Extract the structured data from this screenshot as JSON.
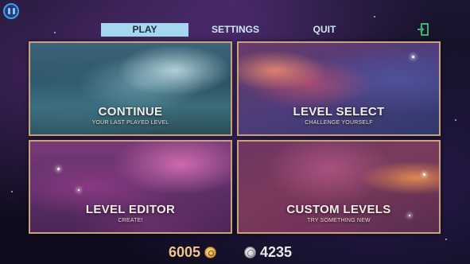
{
  "nav": {
    "tabs": [
      {
        "label": "PLAY",
        "active": true
      },
      {
        "label": "SETTINGS",
        "active": false
      },
      {
        "label": "QUIT",
        "active": false
      }
    ],
    "pause_icon": "pause-icon",
    "exit_icon": "exit-door-icon"
  },
  "cards": [
    {
      "title": "CONTINUE",
      "subtitle": "YOUR LAST PLAYED LEVEL"
    },
    {
      "title": "LEVEL SELECT",
      "subtitle": "CHALLENGE YOURSELF"
    },
    {
      "title": "LEVEL EDITOR",
      "subtitle": "CREATE!"
    },
    {
      "title": "CUSTOM LEVELS",
      "subtitle": "TRY SOMETHING NEW"
    }
  ],
  "currency": {
    "gold": {
      "value": "6005",
      "icon": "gold-coin-icon"
    },
    "silver": {
      "value": "4235",
      "icon": "silver-coin-icon"
    }
  },
  "colors": {
    "active_tab": "#a5d8ee",
    "card_border": "#c9a27e",
    "accent_green": "#39b56a",
    "gold_text": "#f0c58a"
  }
}
